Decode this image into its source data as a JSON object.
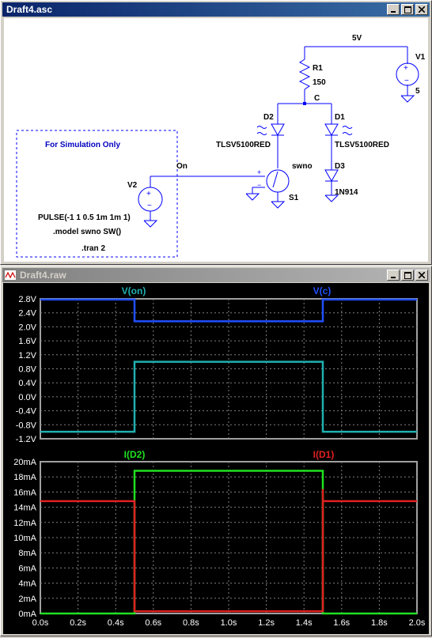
{
  "schematic_window": {
    "title": "Draft4.asc",
    "labels": {
      "net_5v": "5V",
      "v1_name": "V1",
      "v1_value": "5",
      "r1_name": "R1",
      "r1_value": "150",
      "net_c": "C",
      "d2_name": "D2",
      "d1_name": "D1",
      "d2_model": "TLSV5100RED",
      "d1_model": "TLSV5100RED",
      "d3_name": "D3",
      "d3_model": "1N914",
      "sim_box_title": "For Simulation Only",
      "net_on": "On",
      "switch_model": "swno",
      "s1_name": "S1",
      "v2_name": "V2",
      "pulse": "PULSE(-1 1 0.5 1m 1m 1)",
      "model_line": ".model swno SW()",
      "tran_line": ".tran 2"
    }
  },
  "waveform_window": {
    "title": "Draft4.raw"
  },
  "chart_data": [
    {
      "type": "line",
      "title": "",
      "xlabel": "",
      "ylabel": "",
      "xlim": [
        0,
        2.0
      ],
      "ylim": [
        -1.2,
        2.8
      ],
      "yticks": [
        "2.8V",
        "2.4V",
        "2.0V",
        "1.6V",
        "1.2V",
        "0.8V",
        "0.4V",
        "0.0V",
        "-0.4V",
        "-0.8V",
        "-1.2V"
      ],
      "grid": true,
      "background": "#000000",
      "series": [
        {
          "name": "V(on)",
          "color": "#20b0b0",
          "x": [
            0.0,
            0.5,
            0.5,
            1.5,
            1.5,
            2.0
          ],
          "y": [
            -1.0,
            -1.0,
            1.0,
            1.0,
            -1.0,
            -1.0
          ]
        },
        {
          "name": "V(c)",
          "color": "#2050ff",
          "x": [
            0.0,
            0.5,
            0.5,
            1.5,
            1.5,
            2.0
          ],
          "y": [
            2.78,
            2.78,
            2.16,
            2.16,
            2.78,
            2.78
          ]
        }
      ]
    },
    {
      "type": "line",
      "title": "",
      "xlabel": "",
      "ylabel": "",
      "xlim": [
        0,
        2.0
      ],
      "ylim": [
        0,
        20
      ],
      "xticks": [
        "0.0s",
        "0.2s",
        "0.4s",
        "0.6s",
        "0.8s",
        "1.0s",
        "1.2s",
        "1.4s",
        "1.6s",
        "1.8s",
        "2.0s"
      ],
      "yticks": [
        "20mA",
        "18mA",
        "16mA",
        "14mA",
        "12mA",
        "10mA",
        "8mA",
        "6mA",
        "4mA",
        "2mA",
        "0mA"
      ],
      "grid": true,
      "background": "#000000",
      "series": [
        {
          "name": "I(D2)",
          "color": "#20e020",
          "x": [
            0.0,
            0.5,
            0.5,
            0.5,
            1.5,
            1.5,
            1.5,
            2.0
          ],
          "y": [
            0.0,
            0.0,
            16.0,
            18.8,
            18.8,
            16.2,
            0.0,
            0.0
          ]
        },
        {
          "name": "I(D1)",
          "color": "#e02020",
          "x": [
            0.0,
            0.5,
            0.5,
            0.5,
            1.5,
            1.5,
            1.5,
            2.0
          ],
          "y": [
            14.8,
            14.8,
            14.2,
            0.3,
            0.3,
            16.4,
            14.8,
            14.8
          ]
        }
      ]
    }
  ]
}
